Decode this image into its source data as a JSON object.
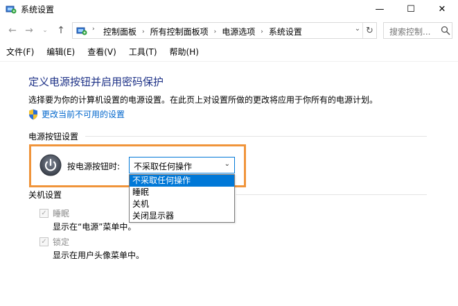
{
  "window": {
    "title": "系统设置",
    "minimize_glyph": "—",
    "maximize_glyph": "☐",
    "close_glyph": "✕"
  },
  "nav": {
    "back_glyph": "←",
    "forward_glyph": "→",
    "recent_glyph": "⌄",
    "up_glyph": "↑",
    "breadcrumb": [
      "控制面板",
      "所有控制面板项",
      "电源选项",
      "系统设置"
    ],
    "breadcrumb_separator": "›",
    "dropdown_glyph": "⌄",
    "refresh_glyph": "↻",
    "search_placeholder": "搜索控制..."
  },
  "menu": [
    "文件(F)",
    "编辑(E)",
    "查看(V)",
    "工具(T)",
    "帮助(H)"
  ],
  "main": {
    "title": "定义电源按钮并启用密码保护",
    "description": "选择要为你的计算机设置的电源设置。在此页上对设置所做的更改将应用于你所有的电源计划。",
    "change_link": "更改当前不可用的设置",
    "power_group_title": "电源按钮设置",
    "power_button_label": "按电源按钮时:",
    "power_button_value": "不采取任何操作",
    "select_chevron": "⌄",
    "dropdown_options": [
      "不采取任何操作",
      "睡眠",
      "关机",
      "关闭显示器"
    ],
    "shutdown_group_title": "关机设置",
    "sleep_label": "睡眠",
    "sleep_desc": "显示在“电源”菜单中。",
    "lock_label": "锁定",
    "lock_desc": "显示在用户头像菜单中。",
    "check_glyph": "✓"
  },
  "colors": {
    "title_blue": "#1e3287",
    "link_blue": "#0066cc",
    "highlight_orange": "#f0943a",
    "selection_blue": "#0078d7"
  },
  "icons": [
    "control-panel-icon",
    "search-icon",
    "shield-icon",
    "power-icon"
  ]
}
